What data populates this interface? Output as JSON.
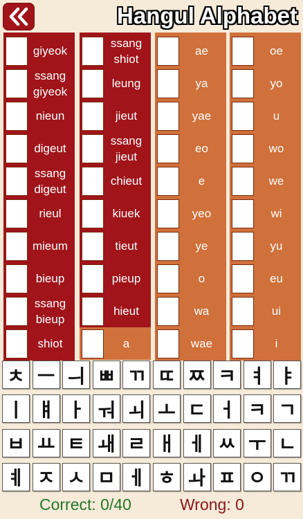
{
  "header": {
    "title": "Hangul Alphabet",
    "back_icon": "double-chevron-left-icon"
  },
  "columns": [
    {
      "color": "#a0141a",
      "items": [
        "giyeok",
        "ssang giyeok",
        "nieun",
        "digeut",
        "ssang digeut",
        "rieul",
        "mieum",
        "bieup",
        "ssang bieup",
        "shiot"
      ]
    },
    {
      "color": "#a0141a",
      "items": [
        "ssang shiot",
        "leung",
        "jieut",
        "ssang jieut",
        "chieut",
        "kiuek",
        "tieut",
        "pieup",
        "hieut",
        "a"
      ]
    },
    {
      "color": "#d0703a",
      "items": [
        "ae",
        "ya",
        "yae",
        "eo",
        "e",
        "yeo",
        "ye",
        "o",
        "wa",
        "wae"
      ]
    },
    {
      "color": "#d0703a",
      "items": [
        "oe",
        "yo",
        "u",
        "wo",
        "we",
        "wi",
        "yu",
        "eu",
        "ui",
        "i"
      ]
    }
  ],
  "tiles": [
    "ㅊ",
    "ㅡ",
    "ㅢ",
    "ㅃ",
    "ㄲ",
    "ㄸ",
    "ㅉ",
    "ㅋ",
    "ㅕ",
    "ㅑ",
    "ㅣ",
    "ㅒ",
    "ㅏ",
    "ㅝ",
    "ㅚ",
    "ㅗ",
    "ㄷ",
    "ㅓ",
    "ㅋ",
    "ㄱ",
    "ㅂ",
    "ㅛ",
    "ㅌ",
    "ㅙ",
    "ㄹ",
    "ㅐ",
    "ㅔ",
    "ㅆ",
    "ㅜ",
    "ㄴ",
    "ㅖ",
    "ㅈ",
    "ㅅ",
    "ㅁ",
    "ㅔ",
    "ㅎ",
    "ㅘ",
    "ㅍ",
    "ㅇ",
    "ㄲ"
  ],
  "footer": {
    "correct_text": "Correct: 0/40",
    "wrong_text": "Wrong: 0",
    "correct_color": "#23772a",
    "wrong_color": "#8a1518"
  }
}
